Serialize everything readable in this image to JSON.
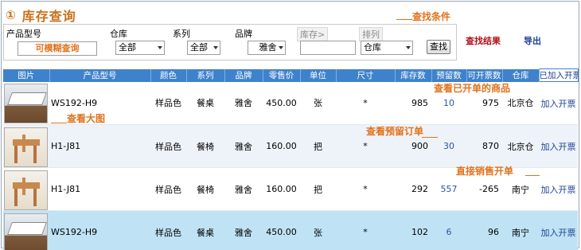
{
  "page": {
    "title_num": "①",
    "title": "库存查询"
  },
  "notes": {
    "filter_conditions": "查找条件",
    "view_invoiced": "查看已开单的商品",
    "view_large_image": "查看大图",
    "view_reserved_orders": "查看预留订单",
    "direct_sales": "直接销售开单"
  },
  "filters": {
    "model_label": "产品型号",
    "model_placeholder": "可模糊查询",
    "warehouse_label": "仓库",
    "warehouse_value": "全部",
    "series_label": "系列",
    "series_value": "全部",
    "brand_label": "品牌",
    "brand_value": "雅舍",
    "stock_label": "库存>",
    "sort_label": "排列",
    "sort_value": "仓库",
    "search_button": "查找",
    "results_link": "查找结果",
    "export_link": "导出"
  },
  "table": {
    "headers": [
      "图片",
      "产品型号",
      "颜色",
      "系列",
      "品牌",
      "零售价",
      "单位",
      "尺寸",
      "库存数",
      "预留数",
      "可开票数",
      "仓库",
      "已加入开票"
    ],
    "rows": [
      {
        "image": "dining-table-image",
        "model": "WS192-H9",
        "color": "样品色",
        "series": "餐桌",
        "brand": "雅舍",
        "price": "450.00",
        "unit": "张",
        "size": "*",
        "stock": "985",
        "reserved": "10",
        "available": "975",
        "warehouse": "北京仓",
        "action": "加入开票"
      },
      {
        "image": "dining-chair-image",
        "model": "H1-J81",
        "color": "样品色",
        "series": "餐椅",
        "brand": "雅舍",
        "price": "160.00",
        "unit": "把",
        "size": "*",
        "stock": "900",
        "reserved": "30",
        "available": "870",
        "warehouse": "北京仓",
        "action": "加入开票"
      },
      {
        "image": "dining-chair-image",
        "model": "H1-J81",
        "color": "样品色",
        "series": "餐椅",
        "brand": "雅舍",
        "price": "160.00",
        "unit": "把",
        "size": "*",
        "stock": "292",
        "reserved": "557",
        "available": "-265",
        "warehouse": "南宁",
        "action": "加入开票"
      },
      {
        "image": "dining-table-image",
        "model": "WS192-H9",
        "color": "样品色",
        "series": "餐桌",
        "brand": "雅舍",
        "price": "450.00",
        "unit": "张",
        "size": "*",
        "stock": "102",
        "reserved": "6",
        "available": "96",
        "warehouse": "南宁",
        "action": "加入开票"
      }
    ]
  },
  "colors": {
    "accent_orange": "#e0721c",
    "header_blue": "#3f82cc",
    "link_red": "#b0121b",
    "link_blue": "#1c3f95",
    "highlight_row": "#bfe3f4"
  }
}
